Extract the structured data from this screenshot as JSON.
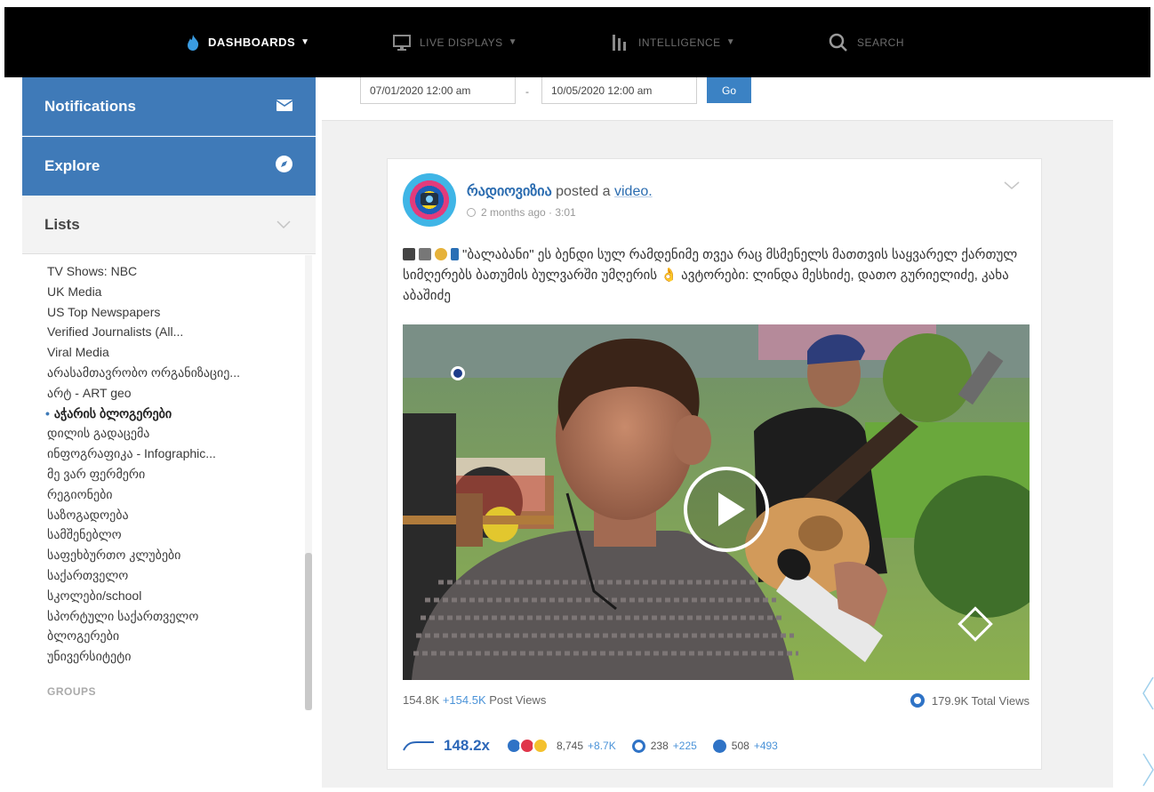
{
  "nav": {
    "dashboards": "DASHBOARDS",
    "live_displays": "LIVE DISPLAYS",
    "intelligence": "INTELLIGENCE",
    "search": "SEARCH"
  },
  "sidebar": {
    "notifications": "Notifications",
    "explore": "Explore",
    "lists_header": "Lists",
    "lists": [
      "TV Shows: NBC",
      "UK Media",
      "US Top Newspapers",
      "Verified Journalists (All...",
      "Viral Media",
      "არასამთავრობო ორგანიზაციე...",
      "არტ - ART geo",
      "აჭარის ბლოგერები",
      "დილის გადაცემა",
      "ინფოგრაფიკა - Infographic...",
      "მე ვარ ფერმერი",
      "რეგიონები",
      "საზოგადოება",
      "სამშენებლო",
      "საფეხბურთო კლუბები",
      "საქართველო",
      "სკოლები/school",
      "სპორტული საქართველო",
      "ბლოგერები",
      "უნივერსიტეტი"
    ],
    "active_index": 7,
    "groups_label": "GROUPS"
  },
  "date_range": {
    "start": "07/01/2020 12:00 am",
    "separator": "-",
    "end": "10/05/2020 12:00 am",
    "go": "Go"
  },
  "post": {
    "author": "რადიოვიზია",
    "action": "posted a",
    "link": "video.",
    "time": "2 months ago · 3:01",
    "text": "\"ბალაბანი\" ეს ბენდი სულ რამდენიმე თვეა რაც მსმენელს მათთვის საყვარელ ქართულ სიმღერებს ბათუმის ბულვარში უმღერის 👌 ავტორები: ლინდა მესხიძე, დათო გურიელიძე, კახა აბაშიძე",
    "post_views": "154.8K",
    "post_views_delta": "+154.5K",
    "post_views_label": "Post Views",
    "total_views": "179.9K Total Views",
    "ratio": "148.2x",
    "reactions": "8,745",
    "reactions_delta": "+8.7K",
    "comments": "238",
    "comments_delta": "+225",
    "shares": "508",
    "shares_delta": "+493"
  },
  "colors": {
    "sidebar_blue": "#3f7ab8",
    "link_blue": "#2b6cb0",
    "delta_blue": "#4b93d8",
    "go_blue": "#3b82c4"
  }
}
